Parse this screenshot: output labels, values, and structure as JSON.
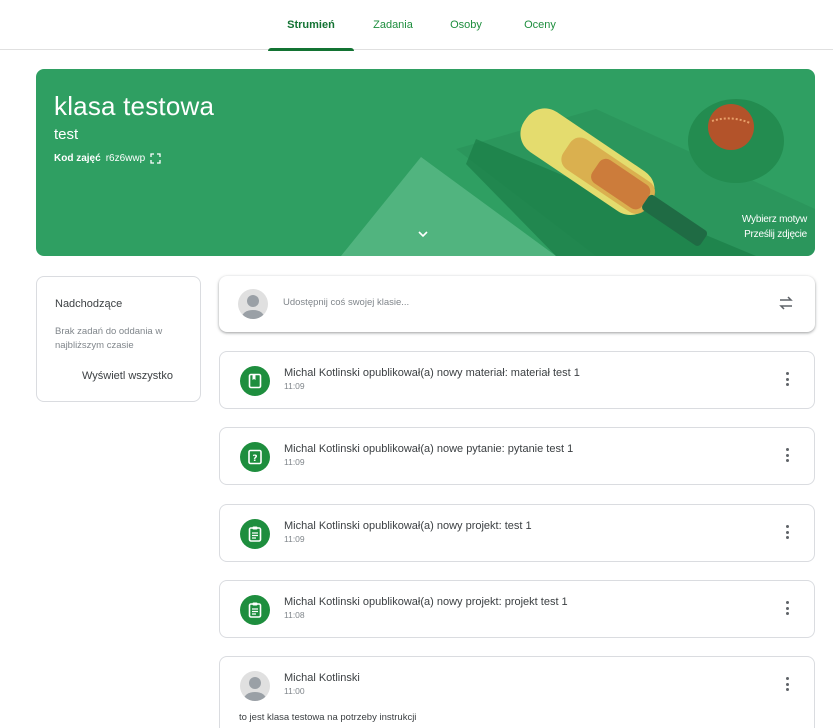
{
  "nav": {
    "tabs": [
      {
        "label": "Strumień",
        "active": true
      },
      {
        "label": "Zadania",
        "active": false
      },
      {
        "label": "Osoby",
        "active": false
      },
      {
        "label": "Oceny",
        "active": false
      }
    ]
  },
  "banner": {
    "title": "klasa testowa",
    "subtitle": "test",
    "code_label": "Kod zajęć",
    "code_value": "r6z6wwp",
    "choose_theme": "Wybierz motyw",
    "upload_photo": "Prześlij zdjęcie",
    "colors": {
      "background": "#2f9f62"
    }
  },
  "upcoming": {
    "title": "Nadchodzące",
    "empty_text": "Brak zadań do oddania w najbliższym czasie",
    "view_all": "Wyświetl wszystko"
  },
  "share": {
    "placeholder": "Udostępnij coś swojej klasie..."
  },
  "posts": [
    {
      "icon": "material-icon",
      "title": "Michal Kotlinski opublikował(a) nowy materiał: materiał test 1",
      "time": "11:09"
    },
    {
      "icon": "question-icon",
      "title": "Michal Kotlinski opublikował(a) nowe pytanie: pytanie test 1",
      "time": "11:09"
    },
    {
      "icon": "assignment-icon",
      "title": "Michal Kotlinski opublikował(a) nowy projekt: test 1",
      "time": "11:09"
    },
    {
      "icon": "assignment-icon",
      "title": "Michal Kotlinski opublikował(a) nowy projekt: projekt test 1",
      "time": "11:08"
    }
  ],
  "announcement": {
    "author": "Michal Kotlinski",
    "time": "11:00",
    "body": "to jest klasa testowa na potrzeby instrukcji"
  },
  "colors": {
    "accent": "#1e8e3e",
    "accent_dark": "#137333"
  }
}
